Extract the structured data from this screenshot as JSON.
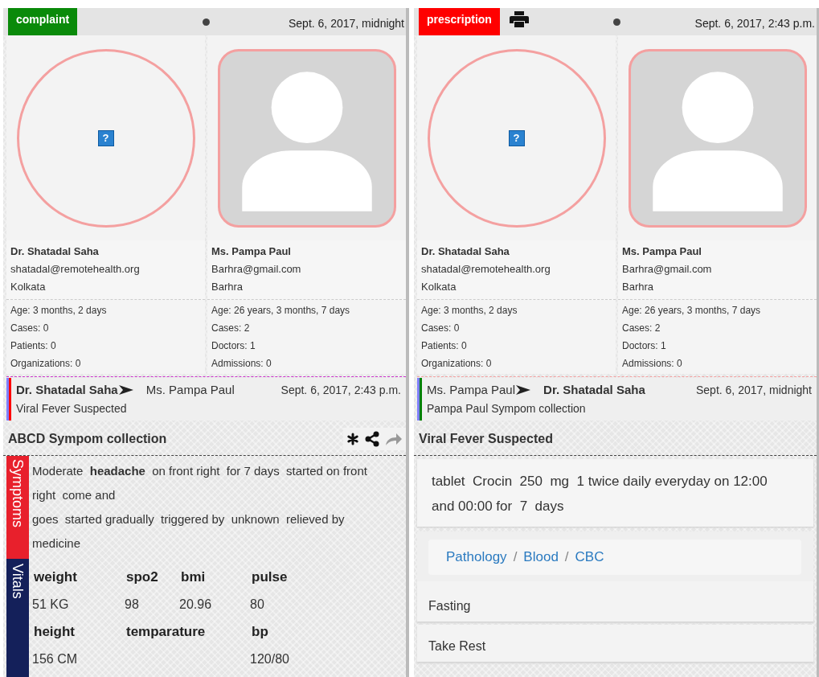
{
  "panels": [
    {
      "tag": {
        "label": "complaint",
        "color": "#0a8a0a"
      },
      "printable": false,
      "date": "Sept. 6, 2017, midnight",
      "profiles": [
        {
          "kind": "broken",
          "glyph": "?",
          "name": "Dr. Shatadal Saha",
          "email": "shatadal@remotehealth.org",
          "city": "Kolkata",
          "stats": [
            "Age: 3 months, 2 days",
            "Cases: 0",
            "Patients: 0",
            "Organizations: 0"
          ]
        },
        {
          "kind": "silhouette",
          "name": "Ms. Pampa Paul",
          "email": "Barhra@gmail.com",
          "city": "Barhra",
          "stats": [
            "Age: 26 years, 3 months, 7 days",
            "Cases: 2",
            "Doctors: 1",
            "Admissions: 0"
          ]
        }
      ],
      "message": {
        "from": {
          "name": "Dr. Shatadal Saha",
          "bold": true
        },
        "to": {
          "name": "Ms. Pampa Paul",
          "bold": false
        },
        "date": "Sept. 6, 2017, 2:43 p.m.",
        "subject": "Viral Fever Suspected",
        "color": "#ff0000",
        "rule": {
          "color": "#cc33cc"
        }
      },
      "title": "ABCD Sympom collection",
      "actions": true,
      "sections": [
        {
          "kind": "symptoms",
          "label": "Symptoms",
          "color": "#e8202c",
          "lines": [
            "Moderate  **headache**  on front right  for 7 days  started on front right  come and",
            "goes  started gradually  triggered by  unknown  relieved by medicine"
          ]
        },
        {
          "kind": "vitals",
          "label": "Vitals",
          "color": "#14205a",
          "rows": [
            {
              "kind": "label",
              "cells": [
                "weight",
                "spo2",
                "bmi",
                "pulse"
              ]
            },
            {
              "kind": "value",
              "cells": [
                "51 KG",
                "98",
                "20.96",
                "80"
              ]
            },
            {
              "kind": "label",
              "cells": [
                "height",
                "temparature",
                "",
                "bp"
              ]
            },
            {
              "kind": "value",
              "cells": [
                "156 CM",
                "",
                "",
                "120/80"
              ]
            }
          ]
        }
      ]
    },
    {
      "tag": {
        "label": "prescription",
        "color": "#ff0000"
      },
      "printable": true,
      "date": "Sept. 6, 2017, 2:43 p.m.",
      "profiles": [
        {
          "kind": "broken",
          "glyph": "?",
          "name": "Dr. Shatadal Saha",
          "email": "shatadal@remotehealth.org",
          "city": "Kolkata",
          "stats": [
            "Age: 3 months, 2 days",
            "Cases: 0",
            "Patients: 0",
            "Organizations: 0"
          ]
        },
        {
          "kind": "silhouette",
          "name": "Ms. Pampa Paul",
          "email": "Barhra@gmail.com",
          "city": "Barhra",
          "stats": [
            "Age: 26 years, 3 months, 7 days",
            "Cases: 2",
            "Doctors: 1",
            "Admissions: 0"
          ]
        }
      ],
      "message": {
        "from": {
          "name": "Ms. Pampa Paul",
          "bold": false
        },
        "to": {
          "name": "Dr. Shatadal Saha",
          "bold": true
        },
        "date": "Sept. 6, 2017, midnight",
        "subject": "Pampa Paul Sympom collection",
        "color": "#008000",
        "rule": {
          "color": "#f4a0a0"
        }
      },
      "title": "Viral Fever Suspected",
      "actions": false,
      "sections": [
        {
          "kind": "medication",
          "text": "tablet  Crocin  250  mg  1 twice daily everyday on 12:00 and 00:00 for  7  days"
        },
        {
          "kind": "breadcrumb",
          "separator": "/",
          "items": [
            "Pathology",
            "Blood",
            "CBC"
          ]
        },
        {
          "kind": "note",
          "text": "Fasting"
        },
        {
          "kind": "note",
          "text": "Take Rest"
        }
      ]
    }
  ]
}
